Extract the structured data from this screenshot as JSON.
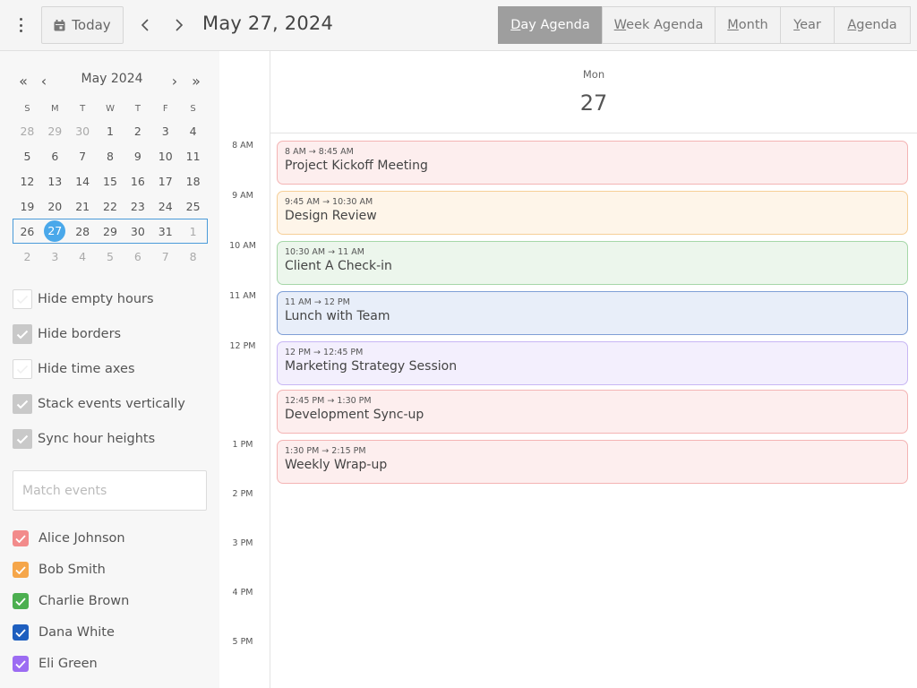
{
  "toolbar": {
    "menu_icon": "kebab-menu-icon",
    "today_label": "Today",
    "today_icon": "calendar-icon",
    "prev_icon": "chevron-left-icon",
    "next_icon": "chevron-right-icon",
    "current_date": "May 27, 2024",
    "views": [
      {
        "label": "Day Agenda",
        "active": true
      },
      {
        "label": "Week Agenda",
        "active": false
      },
      {
        "label": "Month",
        "active": false
      },
      {
        "label": "Year",
        "active": false
      },
      {
        "label": "Agenda",
        "active": false
      }
    ]
  },
  "mini_calendar": {
    "title": "May 2024",
    "nav": {
      "prev_year": "«",
      "prev_month": "‹",
      "next_month": "›",
      "next_year": "»"
    },
    "weekdays": [
      "S",
      "M",
      "T",
      "W",
      "T",
      "F",
      "S"
    ],
    "weeks": [
      [
        {
          "d": "28",
          "m": true
        },
        {
          "d": "29",
          "m": true
        },
        {
          "d": "30",
          "m": true
        },
        {
          "d": "1"
        },
        {
          "d": "2"
        },
        {
          "d": "3"
        },
        {
          "d": "4"
        }
      ],
      [
        {
          "d": "5"
        },
        {
          "d": "6"
        },
        {
          "d": "7"
        },
        {
          "d": "8"
        },
        {
          "d": "9"
        },
        {
          "d": "10"
        },
        {
          "d": "11"
        }
      ],
      [
        {
          "d": "12"
        },
        {
          "d": "13"
        },
        {
          "d": "14"
        },
        {
          "d": "15"
        },
        {
          "d": "16"
        },
        {
          "d": "17"
        },
        {
          "d": "18"
        }
      ],
      [
        {
          "d": "19"
        },
        {
          "d": "20"
        },
        {
          "d": "21"
        },
        {
          "d": "22"
        },
        {
          "d": "23"
        },
        {
          "d": "24"
        },
        {
          "d": "25"
        }
      ],
      [
        {
          "d": "26"
        },
        {
          "d": "27",
          "today": true
        },
        {
          "d": "28"
        },
        {
          "d": "29"
        },
        {
          "d": "30"
        },
        {
          "d": "31"
        },
        {
          "d": "1",
          "m": true
        }
      ],
      [
        {
          "d": "2",
          "m": true
        },
        {
          "d": "3",
          "m": true
        },
        {
          "d": "4",
          "m": true
        },
        {
          "d": "5",
          "m": true
        },
        {
          "d": "6",
          "m": true
        },
        {
          "d": "7",
          "m": true
        },
        {
          "d": "8",
          "m": true
        }
      ]
    ],
    "current_week_index": 4
  },
  "options": [
    {
      "label": "Hide empty hours",
      "checked": false
    },
    {
      "label": "Hide borders",
      "checked": true
    },
    {
      "label": "Hide time axes",
      "checked": false
    },
    {
      "label": "Stack events vertically",
      "checked": true
    },
    {
      "label": "Sync hour heights",
      "checked": true
    }
  ],
  "search": {
    "placeholder": "Match events",
    "value": ""
  },
  "people": [
    {
      "name": "Alice Johnson",
      "color": "#f28b8b",
      "checked": true
    },
    {
      "name": "Bob Smith",
      "color": "#f5a64a",
      "checked": true
    },
    {
      "name": "Charlie Brown",
      "color": "#4caf50",
      "checked": true
    },
    {
      "name": "Dana White",
      "color": "#1e5fbf",
      "checked": true
    },
    {
      "name": "Eli Green",
      "color": "#9c6cf2",
      "checked": true
    }
  ],
  "day_header": {
    "weekday": "Mon",
    "day": "27"
  },
  "hours": [
    "8 AM",
    "9 AM",
    "10 AM",
    "11 AM",
    "12 PM",
    "1 PM",
    "2 PM",
    "3 PM",
    "4 PM",
    "5 PM"
  ],
  "events": [
    {
      "time": "8 AM → 8:45 AM",
      "title": "Project Kickoff Meeting",
      "bg": "#fdeeee",
      "border": "#f4b4b4"
    },
    {
      "time": "9:45 AM → 10:30 AM",
      "title": "Design Review",
      "bg": "#fef5e9",
      "border": "#f6cf98"
    },
    {
      "time": "10:30 AM → 11 AM",
      "title": "Client A Check-in",
      "bg": "#ecf6ec",
      "border": "#a6d7a8"
    },
    {
      "time": "11 AM → 12 PM",
      "title": "Lunch with Team",
      "bg": "#e8eef9",
      "border": "#7f9fd6"
    },
    {
      "time": "12 PM → 12:45 PM",
      "title": "Marketing Strategy Session",
      "bg": "#f3effd",
      "border": "#c8b6f4"
    },
    {
      "time": "12:45 PM → 1:30 PM",
      "title": "Development Sync-up",
      "bg": "#fdeeee",
      "border": "#f4b4b4"
    },
    {
      "time": "1:30 PM → 2:15 PM",
      "title": "Weekly Wrap-up",
      "bg": "#fdeeee",
      "border": "#f4b4b4"
    }
  ]
}
